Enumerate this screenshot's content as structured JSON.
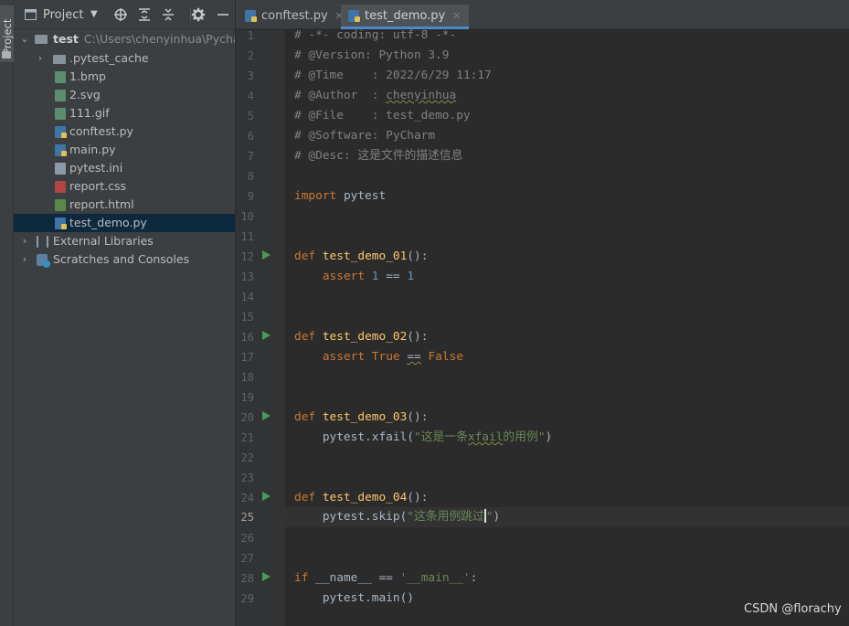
{
  "tool_strip": {
    "tab_label": "Project"
  },
  "project_panel": {
    "title": "Project",
    "tools": [
      "crosshair-icon",
      "expand-all-icon",
      "collapse-all-icon",
      "gear-icon",
      "minimize-icon"
    ]
  },
  "tree": {
    "root": {
      "name": "test",
      "path": "C:\\Users\\chenyinhua\\Pycharm"
    },
    "items": [
      {
        "label": ".pytest_cache",
        "kind": "folder"
      },
      {
        "label": "1.bmp",
        "kind": "img"
      },
      {
        "label": "2.svg",
        "kind": "img"
      },
      {
        "label": "111.gif",
        "kind": "img"
      },
      {
        "label": "conftest.py",
        "kind": "py"
      },
      {
        "label": "main.py",
        "kind": "py"
      },
      {
        "label": "pytest.ini",
        "kind": "ini"
      },
      {
        "label": "report.css",
        "kind": "css"
      },
      {
        "label": "report.html",
        "kind": "html"
      },
      {
        "label": "test_demo.py",
        "kind": "py"
      }
    ],
    "external_libraries": "External Libraries",
    "scratches": "Scratches and Consoles"
  },
  "tabs": [
    {
      "label": "conftest.py",
      "active": false
    },
    {
      "label": "test_demo.py",
      "active": true
    }
  ],
  "editor": {
    "current_line": 25,
    "line_numbers": [
      "1",
      "2",
      "3",
      "4",
      "5",
      "6",
      "7",
      "8",
      "9",
      "10",
      "11",
      "12",
      "13",
      "14",
      "15",
      "16",
      "17",
      "18",
      "19",
      "20",
      "21",
      "22",
      "23",
      "24",
      "25",
      "26",
      "27",
      "28",
      "29"
    ],
    "lines": {
      "l1": "# -*- coding: utf-8 -*-",
      "l2": "# @Version: Python 3.9",
      "l3": "# @Time    : 2022/6/29 11:17",
      "l4a": "# @Author  : ",
      "l4b": "chenyinhua",
      "l5": "# @File    : test_demo.py",
      "l6": "# @Software: PyCharm",
      "l7": "# @Desc: 这是文件的描述信息",
      "l9a": "import",
      "l9b": " pytest",
      "l12a": "def",
      "l12b": " ",
      "l12c": "test_demo_01",
      "l12d": "():",
      "l13a": "    ",
      "l13b": "assert",
      "l13c": " ",
      "l13d": "1",
      "l13e": " == ",
      "l13f": "1",
      "l16a": "def",
      "l16c": "test_demo_02",
      "l16d": "():",
      "l17b": "assert",
      "l17c": " ",
      "l17d": "True",
      "l17e": " ",
      "l17f": "==",
      "l17g": " ",
      "l17h": "False",
      "l20a": "def",
      "l20c": "test_demo_03",
      "l20d": "():",
      "l21a": "    pytest.xfail(",
      "l21b": "\"这是一条",
      "l21c": "xfail",
      "l21d": "的用例\"",
      "l21e": ")",
      "l24a": "def",
      "l24c": "test_demo_04",
      "l24d": "():",
      "l25a": "    pytest.skip(",
      "l25b": "\"这条用例跳过",
      "l25c": "\"",
      "l25d": ")",
      "l28a": "if",
      "l28b": " __name__ == ",
      "l28c": "'__main__'",
      "l28d": ":",
      "l29a": "    pytest.main()"
    },
    "run_marker_lines": [
      12,
      16,
      20,
      24,
      28
    ]
  },
  "watermark": "CSDN @florachy",
  "colors": {
    "keyword": "#cc7832",
    "function": "#ffc66d",
    "number": "#6897bb",
    "string": "#6a8759",
    "comment": "#808080",
    "run_marker": "#499c54"
  }
}
